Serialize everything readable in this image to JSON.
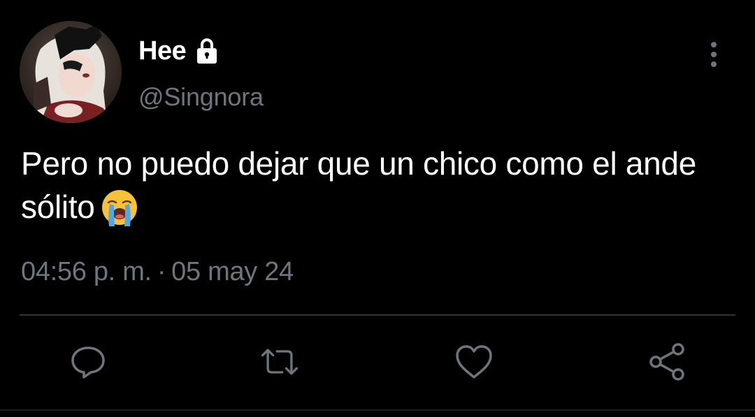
{
  "tweet": {
    "display_name": "Hee",
    "handle": "@Singnora",
    "text": "Pero no puedo dejar que un chico como el ande sólito",
    "emoji": "loudly-crying-face",
    "time": "04:56 p. m.",
    "separator": "·",
    "date": "05 may 24"
  },
  "icons": {
    "lock": "lock-icon",
    "more": "more-vertical-icon",
    "reply": "comment-bubble-icon",
    "retweet": "retweet-icon",
    "like": "heart-icon",
    "share": "share-icon"
  },
  "colors": {
    "background": "#000000",
    "text": "#ffffff",
    "secondary": "#6e767d",
    "divider": "#2f3336"
  }
}
